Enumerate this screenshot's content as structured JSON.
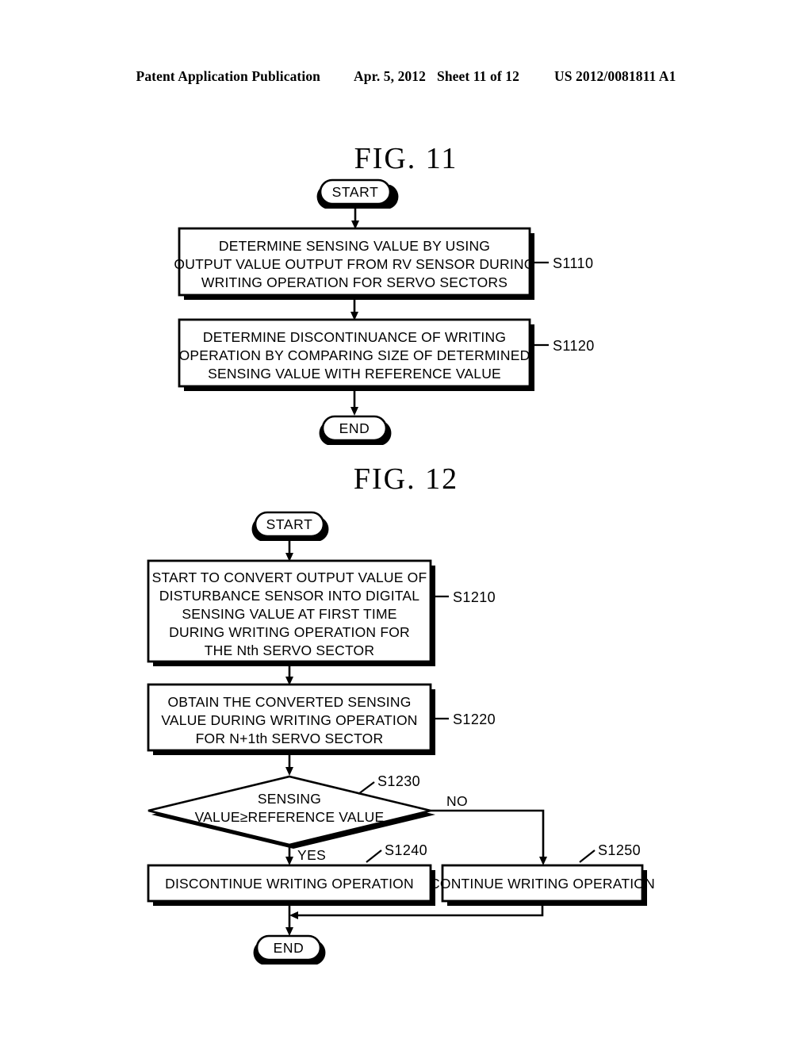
{
  "header": {
    "publication": "Patent Application Publication",
    "date": "Apr. 5, 2012",
    "sheet": "Sheet 11 of 12",
    "doc_number": "US 2012/0081811 A1"
  },
  "figures": [
    {
      "id": "fig11",
      "title": "FIG.  11",
      "nodes": {
        "start": {
          "label": "START",
          "shape": "terminator"
        },
        "s1110": {
          "ref": "S1110",
          "shape": "process",
          "lines": [
            "DETERMINE SENSING VALUE BY USING",
            "OUTPUT VALUE OUTPUT FROM RV SENSOR DURING",
            "WRITING OPERATION FOR SERVO SECTORS"
          ]
        },
        "s1120": {
          "ref": "S1120",
          "shape": "process",
          "lines": [
            "DETERMINE DISCONTINUANCE OF WRITING",
            "OPERATION BY COMPARING SIZE OF DETERMINED",
            "SENSING VALUE WITH REFERENCE VALUE"
          ]
        },
        "end": {
          "label": "END",
          "shape": "terminator"
        }
      }
    },
    {
      "id": "fig12",
      "title": "FIG.  12",
      "nodes": {
        "start": {
          "label": "START",
          "shape": "terminator"
        },
        "s1210": {
          "ref": "S1210",
          "shape": "process",
          "lines": [
            "START TO CONVERT OUTPUT VALUE OF",
            "DISTURBANCE SENSOR INTO DIGITAL",
            "SENSING VALUE AT FIRST TIME",
            "DURING WRITING OPERATION FOR",
            "THE Nth SERVO SECTOR"
          ]
        },
        "s1220": {
          "ref": "S1220",
          "shape": "process",
          "lines": [
            "OBTAIN THE CONVERTED SENSING",
            "VALUE DURING WRITING OPERATION",
            "FOR N+1th SERVO SECTOR"
          ]
        },
        "s1230": {
          "ref": "S1230",
          "shape": "decision",
          "lines": [
            "SENSING",
            "VALUE≥REFERENCE VALUE"
          ],
          "branch_yes": "YES",
          "branch_no": "NO"
        },
        "s1240": {
          "ref": "S1240",
          "shape": "process",
          "lines": [
            "DISCONTINUE WRITING OPERATION"
          ]
        },
        "s1250": {
          "ref": "S1250",
          "shape": "process",
          "lines": [
            "CONTINUE WRITING OPERATION"
          ]
        },
        "end": {
          "label": "END",
          "shape": "terminator"
        }
      }
    }
  ],
  "colors": {
    "ink": "#000000",
    "paper": "#ffffff"
  }
}
